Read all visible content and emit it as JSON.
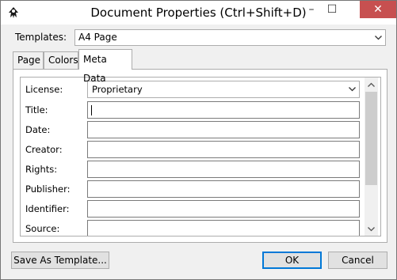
{
  "window": {
    "title": "Document Properties (Ctrl+Shift+D)",
    "minimize_glyph": "–",
    "maximize_glyph": "☐",
    "close_glyph": "✕"
  },
  "templates": {
    "label": "Templates:",
    "value": "A4 Page"
  },
  "tabs": [
    {
      "label": "Page",
      "active": false
    },
    {
      "label": "Colors",
      "active": false
    },
    {
      "label": "Meta Data",
      "active": true
    }
  ],
  "metadata": {
    "license_label": "License:",
    "license_value": "Proprietary",
    "fields": [
      {
        "label": "Title:",
        "value": ""
      },
      {
        "label": "Date:",
        "value": ""
      },
      {
        "label": "Creator:",
        "value": ""
      },
      {
        "label": "Rights:",
        "value": ""
      },
      {
        "label": "Publisher:",
        "value": ""
      },
      {
        "label": "Identifier:",
        "value": ""
      },
      {
        "label": "Source:",
        "value": ""
      }
    ]
  },
  "buttons": {
    "save_template": "Save As Template...",
    "ok": "OK",
    "cancel": "Cancel"
  },
  "colors": {
    "close_button": "#c75050",
    "default_button_border": "#0078d7"
  }
}
